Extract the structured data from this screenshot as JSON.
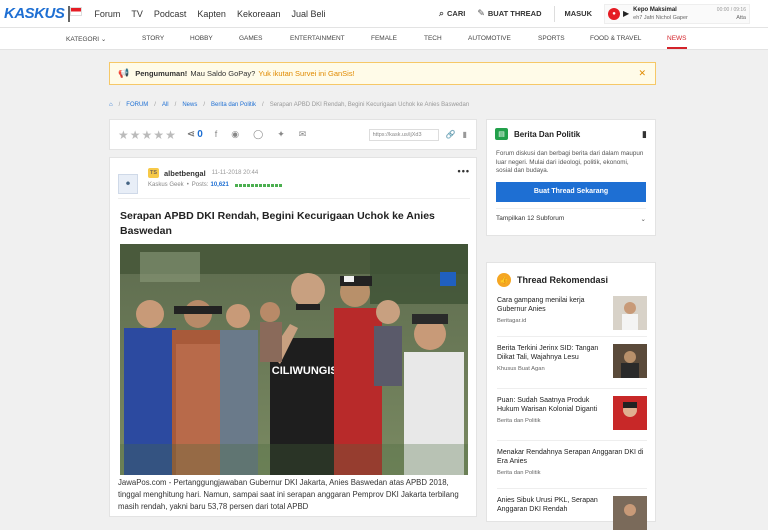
{
  "header": {
    "logo": "KASKUS",
    "nav": [
      "Forum",
      "TV",
      "Podcast",
      "Kapten",
      "Kekoreaan",
      "Jual Beli"
    ],
    "search_label": "CARI",
    "create_thread_label": "BUAT THREAD",
    "login_label": "MASUK",
    "player": {
      "title": "Kepo Maksimal",
      "subtitle": "eh7 Jafri Nichol Gaper",
      "time": "00:00 / 09:16",
      "label": "Atta"
    }
  },
  "categories": [
    "KATEGORI",
    "STORY",
    "HOBBY",
    "GAMES",
    "ENTERTAINMENT",
    "FEMALE",
    "TECH",
    "AUTOMOTIVE",
    "SPORTS",
    "FOOD & TRAVEL",
    "NEWS"
  ],
  "announcement": {
    "label": "Pengumuman!",
    "text": "Mau Saldo GoPay?",
    "link": "Yuk ikutan Survei ini GanSis!"
  },
  "breadcrumb": [
    "FORUM",
    "All",
    "News",
    "Berita dan Politik",
    "Serapan APBD DKI Rendah, Begini Kecurigaan Uchok ke Anies Baswedan"
  ],
  "sharebar": {
    "share_count": "0",
    "url": "https://kask.us/ijXd3"
  },
  "post": {
    "user_badge": "TS",
    "username": "albetbengal",
    "date": "11-11-2018 20:44",
    "rank": "Kaskus Geek",
    "posts_label": "Posts:",
    "posts": "10,621",
    "title": "Serapan APBD DKI Rendah, Begini Kecurigaan Uchok ke Anies Baswedan",
    "shirt_text": "CILIWUNGISME",
    "body": "JawaPos.com - Pertanggungjawaban Gubernur DKI Jakarta, Anies Baswedan atas APBD 2018, tinggal menghitung hari. Namun, sampai saat ini serapan anggaran Pemprov DKI Jakarta terbilang masih rendah, yakni baru 53,78 persen dari total APBD"
  },
  "forum_card": {
    "title": "Berita Dan Politik",
    "description": "Forum diskusi dan berbagi berita dari dalam maupun luar negeri. Mulai dari ideologi, politik, ekonomi, sosial dan budaya.",
    "button": "Buat Thread Sekarang",
    "subforum": "Tampilkan 12 Subforum"
  },
  "recommendations": {
    "title": "Thread Rekomendasi",
    "items": [
      {
        "title": "Cara gampang menilai kerja Gubernur Anies",
        "source": "Beritagar.id"
      },
      {
        "title": "Berita Terkini Jerinx SID: Tangan Diikat Tali, Wajahnya Lesu",
        "source": "Khusus Buat Agan"
      },
      {
        "title": "Puan: Sudah Saatnya Produk Hukum Warisan Kolonial Diganti",
        "source": "Berita dan Politik"
      },
      {
        "title": "Menakar Rendahnya Serapan Anggaran DKI di Era Anies",
        "source": "Berita dan Politik"
      },
      {
        "title": "Anies Sibuk Urusi PKL, Serapan Anggaran DKI Rendah",
        "source": ""
      }
    ]
  }
}
